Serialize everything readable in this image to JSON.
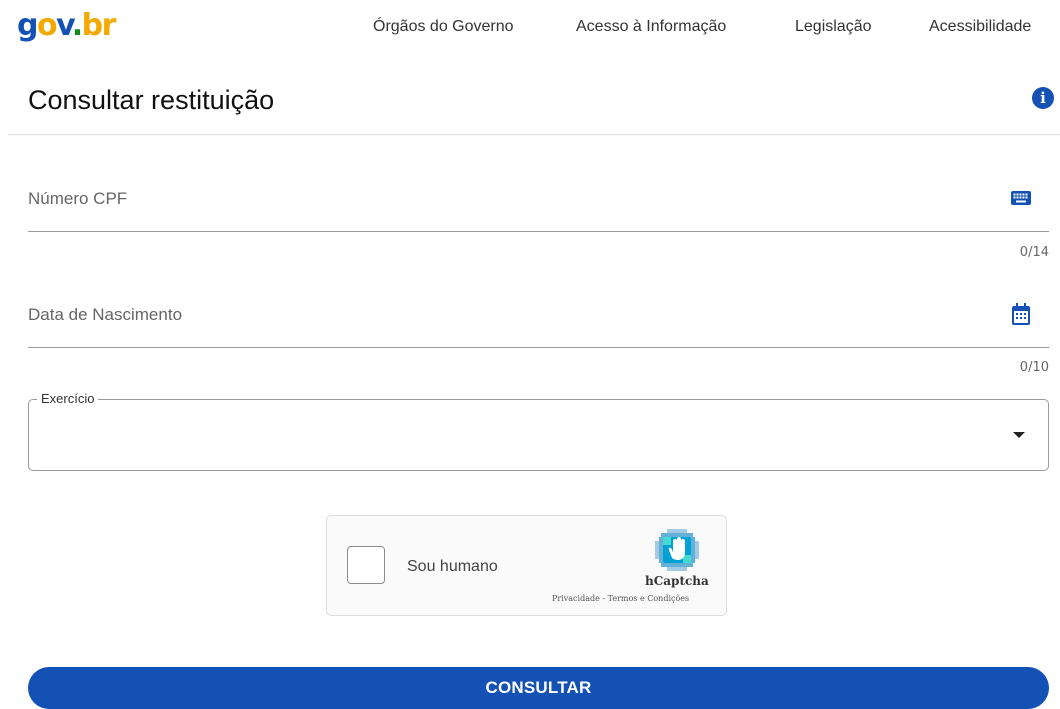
{
  "header": {
    "logo": {
      "g": "g",
      "o": "o",
      "v": "v",
      "dot": ".",
      "br": "br"
    },
    "nav": [
      "Órgãos do Governo",
      "Acesso à Informação",
      "Legislação",
      "Acessibilidade"
    ]
  },
  "page": {
    "title": "Consultar restituição",
    "info_icon": "i"
  },
  "form": {
    "cpf": {
      "label": "Número CPF",
      "counter": "0/14",
      "icon": "keyboard-icon"
    },
    "nascimento": {
      "label": "Data de Nascimento",
      "counter": "0/10",
      "icon": "calendar-icon"
    },
    "exercicio": {
      "label": "Exercício",
      "value": ""
    }
  },
  "captcha": {
    "checkbox_label": "Sou humano",
    "brand": "hCaptcha",
    "links": "Privacidade - Termos e Condições"
  },
  "submit": {
    "label": "CONSULTAR"
  },
  "colors": {
    "primary": "#1351b4",
    "logo_yellow": "#f2a900",
    "logo_green": "#168821"
  }
}
